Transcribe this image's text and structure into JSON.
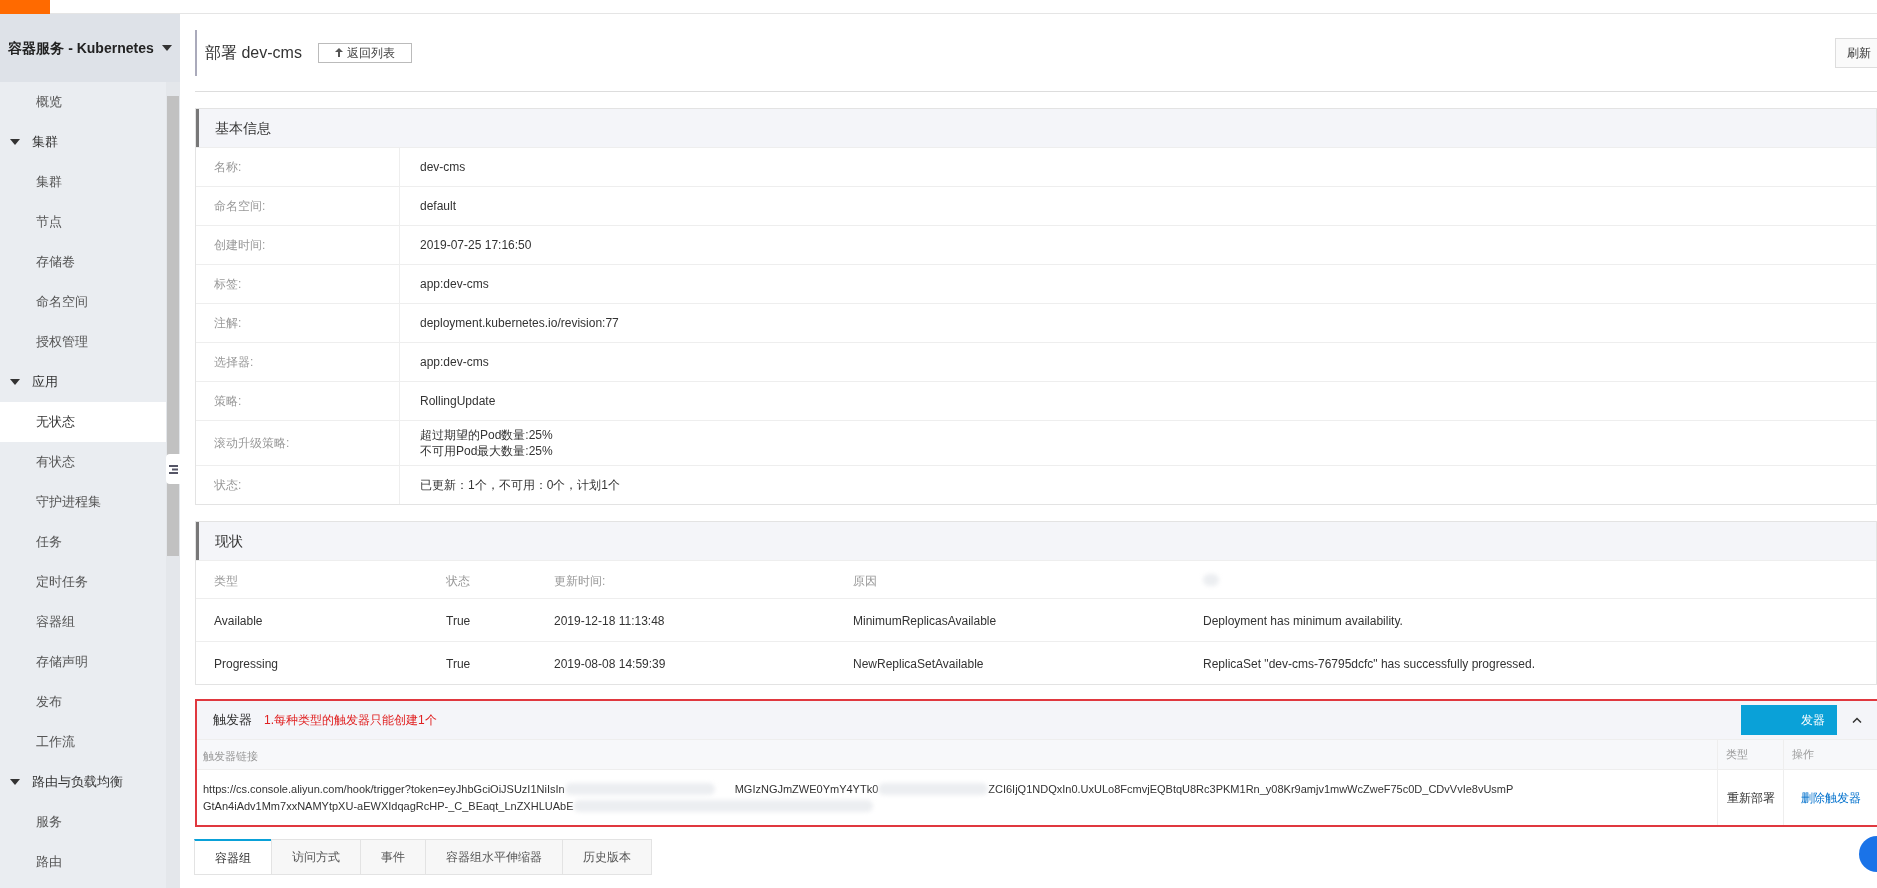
{
  "sidebar": {
    "title": "容器服务 - Kubernetes",
    "items": [
      {
        "label": "概览",
        "selected": false
      },
      {
        "label": "集群",
        "expanded": true,
        "children": [
          {
            "label": "集群",
            "selected": false
          },
          {
            "label": "节点",
            "selected": false
          },
          {
            "label": "存储卷",
            "selected": false
          },
          {
            "label": "命名空间",
            "selected": false
          },
          {
            "label": "授权管理",
            "selected": false
          }
        ]
      },
      {
        "label": "应用",
        "expanded": true,
        "children": [
          {
            "label": "无状态",
            "selected": true
          },
          {
            "label": "有状态",
            "selected": false
          },
          {
            "label": "守护进程集",
            "selected": false
          },
          {
            "label": "任务",
            "selected": false
          },
          {
            "label": "定时任务",
            "selected": false
          },
          {
            "label": "容器组",
            "selected": false
          },
          {
            "label": "存储声明",
            "selected": false
          },
          {
            "label": "发布",
            "selected": false
          },
          {
            "label": "工作流",
            "selected": false
          }
        ]
      },
      {
        "label": "路由与负载均衡",
        "expanded": true,
        "children": [
          {
            "label": "服务",
            "selected": false
          },
          {
            "label": "路由",
            "selected": false
          }
        ]
      }
    ]
  },
  "header": {
    "title": "部署 dev-cms",
    "back_button": "返回列表",
    "refresh_button": "刷新"
  },
  "basic_info": {
    "title": "基本信息",
    "rows": [
      {
        "label": "名称:",
        "values": [
          "dev-cms"
        ]
      },
      {
        "label": "命名空间:",
        "values": [
          "default"
        ]
      },
      {
        "label": "创建时间:",
        "values": [
          "2019-07-25 17:16:50"
        ]
      },
      {
        "label": "标签:",
        "values": [
          "app:dev-cms"
        ]
      },
      {
        "label": "注解:",
        "values": [
          "deployment.kubernetes.io/revision:77"
        ]
      },
      {
        "label": "选择器:",
        "values": [
          "app:dev-cms"
        ]
      },
      {
        "label": "策略:",
        "values": [
          "RollingUpdate"
        ]
      },
      {
        "label": "滚动升级策略:",
        "values": [
          "超过期望的Pod数量:25%",
          "不可用Pod最大数量:25%"
        ]
      },
      {
        "label": "状态:",
        "values": [
          "已更新：1个，不可用：0个，计划1个"
        ]
      }
    ]
  },
  "status": {
    "title": "现状",
    "columns": [
      "类型",
      "状态",
      "更新时间:",
      "原因"
    ],
    "rows": [
      {
        "cells": [
          "Available",
          "True",
          "2019-12-18 11:13:48",
          "MinimumReplicasAvailable",
          "Deployment has minimum availability."
        ]
      },
      {
        "cells": [
          "Progressing",
          "True",
          "2019-08-08 14:59:39",
          "NewReplicaSetAvailable",
          "ReplicaSet \"dev-cms-76795dcfc\" has successfully progressed."
        ]
      }
    ]
  },
  "trigger": {
    "title": "触发器",
    "note": "1.每种类型的触发器只能创建1个",
    "create_button": "发器",
    "expanded": true,
    "columns": [
      "触发器链接",
      "类型",
      "操作"
    ],
    "rows": [
      {
        "link_line_1": [
          "https://cs.console.aliyun.com/hook/trigger?token=eyJhbGciOiJSUzI1NiIsIn",
          "MGIzNGJmZWE0YmY4YTk0",
          "ZCI6IjQ1NDQxIn0.UxULo8FcmvjEQBtqU8Rc3PKM1Rn_y08Kr9amjv1mwWcZweF75c0D_CDvVvIe8vUsmP"
        ],
        "link_line_2": "GtAn4iAdv1Mm7xxNAMYtpXU-aEWXIdqagRcHP-_C_BEaqt_LnZXHLUAbE",
        "type": "重新部署",
        "action": "删除触发器"
      }
    ]
  },
  "tabs": [
    {
      "label": "容器组",
      "selected": true
    },
    {
      "label": "访问方式",
      "selected": false
    },
    {
      "label": "事件",
      "selected": false
    },
    {
      "label": "容器组水平伸缩器",
      "selected": false
    },
    {
      "label": "历史版本",
      "selected": false
    }
  ]
}
